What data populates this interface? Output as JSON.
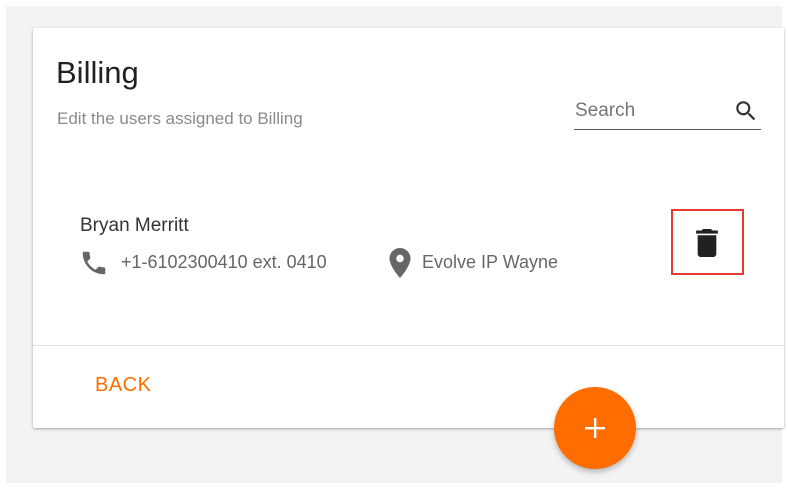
{
  "group": {
    "title": "Billing",
    "subtitle": "Edit the users assigned to Billing"
  },
  "search": {
    "placeholder": "Search",
    "icon": "search-icon"
  },
  "users": [
    {
      "name": "Bryan Merritt",
      "phone": "+1-6102300410 ext. 0410",
      "location": "Evolve IP Wayne",
      "phone_icon": "phone-icon",
      "location_icon": "location-pin-icon",
      "delete_icon": "trash-icon"
    }
  ],
  "footer": {
    "back_label": "BACK"
  },
  "fab": {
    "icon": "plus-icon"
  },
  "colors": {
    "accent": "#ff6d00",
    "highlight_border": "#e53935",
    "text_primary": "#212121",
    "text_secondary": "#8a8a8a",
    "icon_gray": "#666666"
  }
}
